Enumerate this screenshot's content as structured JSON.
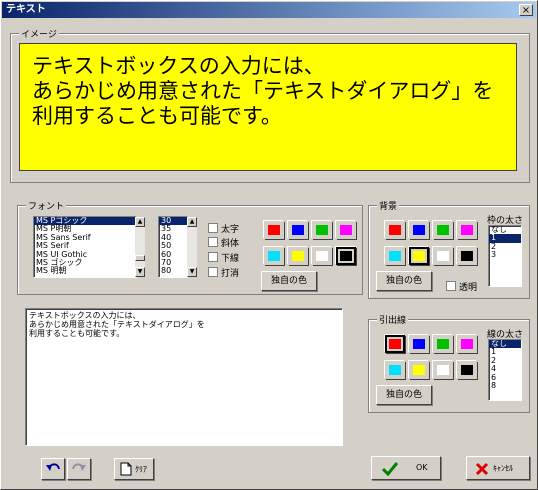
{
  "window": {
    "title": "テキスト",
    "close_label": "×"
  },
  "image_group": {
    "label": "イメージ"
  },
  "preview": {
    "lines": [
      "テキストボックスの入力には、",
      "あらかじめ用意された「テキストダイアログ」を",
      "利用することも可能です。"
    ],
    "background": "#ffff00"
  },
  "font_group": {
    "label": "フォント",
    "fonts": [
      "MS Pゴシック",
      "MS P明朝",
      "MS Sans Serif",
      "MS Serif",
      "MS UI Gothic",
      "MS ゴシック",
      "MS 明朝"
    ],
    "selected_font": 0,
    "sizes": [
      "30",
      "35",
      "40",
      "50",
      "60",
      "70",
      "80"
    ],
    "selected_size": 0,
    "styles": [
      "太字",
      "斜体",
      "下線",
      "打消"
    ],
    "custom_color_label": "独自の色"
  },
  "bg_group": {
    "label": "背景",
    "border_width_label": "枠の太さ",
    "border_widths": [
      "なし",
      "1",
      "2",
      "3"
    ],
    "selected_width": 1,
    "custom_color_label": "独自の色",
    "transparent_label": "透明"
  },
  "lead_group": {
    "label": "引出線",
    "line_width_label": "線の太さ",
    "line_widths": [
      "なし",
      "1",
      "2",
      "4",
      "6",
      "8"
    ],
    "selected_width": 0,
    "custom_color_label": "独自の色"
  },
  "textarea": {
    "lines": [
      "テキストボックスの入力には、",
      "あらかじめ用意された「テキストダイアログ」を",
      "利用することも可能です。"
    ]
  },
  "palette": [
    "#ff0000",
    "#0000ff",
    "#00c000",
    "#ff00ff",
    "#00e0ff",
    "#ffff00",
    "#ffffff",
    "#000000"
  ],
  "bottom": {
    "undo_icon": "undo-arrow",
    "redo_icon": "redo-arrow",
    "clear_label": "ｸﾘｱ",
    "ok_label": "OK",
    "cancel_label": "ｷｬﾝｾﾙ"
  }
}
